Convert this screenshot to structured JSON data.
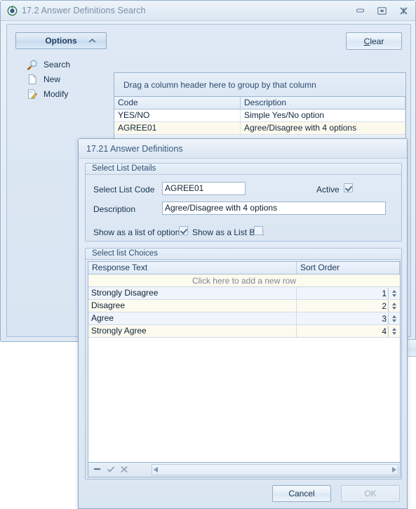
{
  "window": {
    "title": "17.2 Answer Definitions Search",
    "icon": "app-icon",
    "buttons": {
      "minimize": "minimize-icon",
      "restore": "restore-icon",
      "close": "close-icon"
    },
    "options_panel": {
      "header_label": "Options",
      "collapse_chevron": "chevron-up-icon",
      "items": [
        {
          "label": "Search",
          "icon": "magnifier-icon"
        },
        {
          "label": "New",
          "icon": "page-icon"
        },
        {
          "label": "Modify",
          "icon": "pencil-page-icon"
        }
      ]
    },
    "clear_button": {
      "label": "Clear",
      "accelerator": "C"
    },
    "grid": {
      "group_hint": "Drag a column header here to group by that column",
      "columns": [
        "Code",
        "Description"
      ],
      "rows": [
        {
          "code": "YES/NO",
          "description": "Simple Yes/No option"
        },
        {
          "code": "AGREE01",
          "description": "Agree/Disagree with 4 options"
        },
        {
          "code": "",
          "description": ""
        },
        {
          "code": "",
          "description": ""
        },
        {
          "code": "",
          "description": ""
        },
        {
          "code": "",
          "description": ""
        },
        {
          "code": "",
          "description": ""
        }
      ]
    }
  },
  "dialog": {
    "title": "17.21 Answer Definitions",
    "details_group": {
      "title": "Select List Details",
      "code_label": "Select List Code",
      "code_value": "AGREE01",
      "description_label": "Description",
      "description_value": "Agree/Disagree with 4 options",
      "active_label": "Active",
      "active_checked": true,
      "show_as_list_label": "Show as a list of options",
      "show_as_list_checked": true,
      "show_as_listbox_label": "Show as a List Box",
      "show_as_listbox_checked": false
    },
    "choices_group": {
      "title": "Select list Choices",
      "columns": [
        "Response Text",
        "Sort Order"
      ],
      "new_row_hint": "Click here to add a new row",
      "rows": [
        {
          "response_text": "Strongly Disagree",
          "sort_order": "1"
        },
        {
          "response_text": "Disagree",
          "sort_order": "2"
        },
        {
          "response_text": "Agree",
          "sort_order": "3"
        },
        {
          "response_text": "Strongly Agree",
          "sort_order": "4"
        }
      ],
      "footer_icons": [
        "delete-row-icon",
        "confirm-row-icon",
        "cancel-row-icon"
      ],
      "scroll_left_icon": "scroll-left-icon",
      "scroll_right_icon": "scroll-right-icon"
    },
    "buttons": {
      "cancel": "Cancel",
      "ok": "OK"
    }
  },
  "colors": {
    "title_text": "#7a8fa6",
    "body_text": "#17344f",
    "window_border": "#96b0cc",
    "panel_bg": "#dfe9f5",
    "row_alt_cream": "#fdf9ec",
    "row_alt_blue": "#eef3fa"
  }
}
